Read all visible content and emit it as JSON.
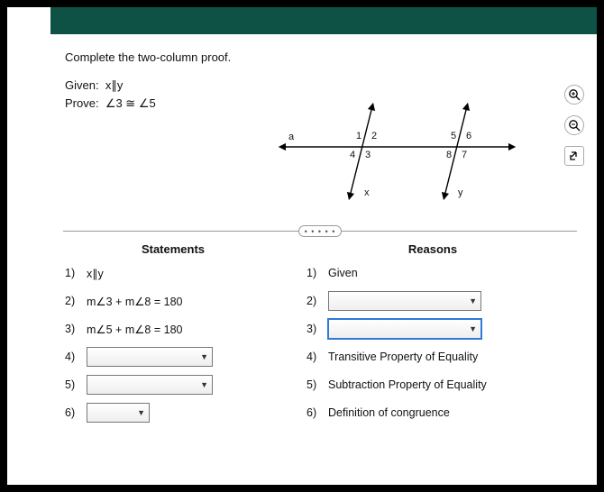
{
  "prompt": "Complete the two-column proof.",
  "given_label": "Given:",
  "given_value": "x∥y",
  "prove_label": "Prove:",
  "prove_value": "∠3 ≅ ∠5",
  "diagram": {
    "line_label": "a",
    "trans1": "x",
    "trans2": "y",
    "angles": {
      "a1": "1",
      "a2": "2",
      "a3": "3",
      "a4": "4",
      "a5": "5",
      "a6": "6",
      "a7": "7",
      "a8": "8"
    }
  },
  "headers": {
    "statements": "Statements",
    "reasons": "Reasons"
  },
  "statements": {
    "r1": {
      "n": "1)",
      "text": "x∥y"
    },
    "r2": {
      "n": "2)",
      "text": "m∠3 + m∠8 = 180"
    },
    "r3": {
      "n": "3)",
      "text": "m∠5 + m∠8 = 180"
    },
    "r4": {
      "n": "4)"
    },
    "r5": {
      "n": "5)"
    },
    "r6": {
      "n": "6)"
    }
  },
  "reasons": {
    "r1": {
      "n": "1)",
      "text": "Given"
    },
    "r2": {
      "n": "2)"
    },
    "r3": {
      "n": "3)"
    },
    "r4": {
      "n": "4)",
      "text": "Transitive Property of Equality"
    },
    "r5": {
      "n": "5)",
      "text": "Subtraction Property of Equality"
    },
    "r6": {
      "n": "6)",
      "text": "Definition of congruence"
    }
  },
  "ellipsis": "• • • • •"
}
